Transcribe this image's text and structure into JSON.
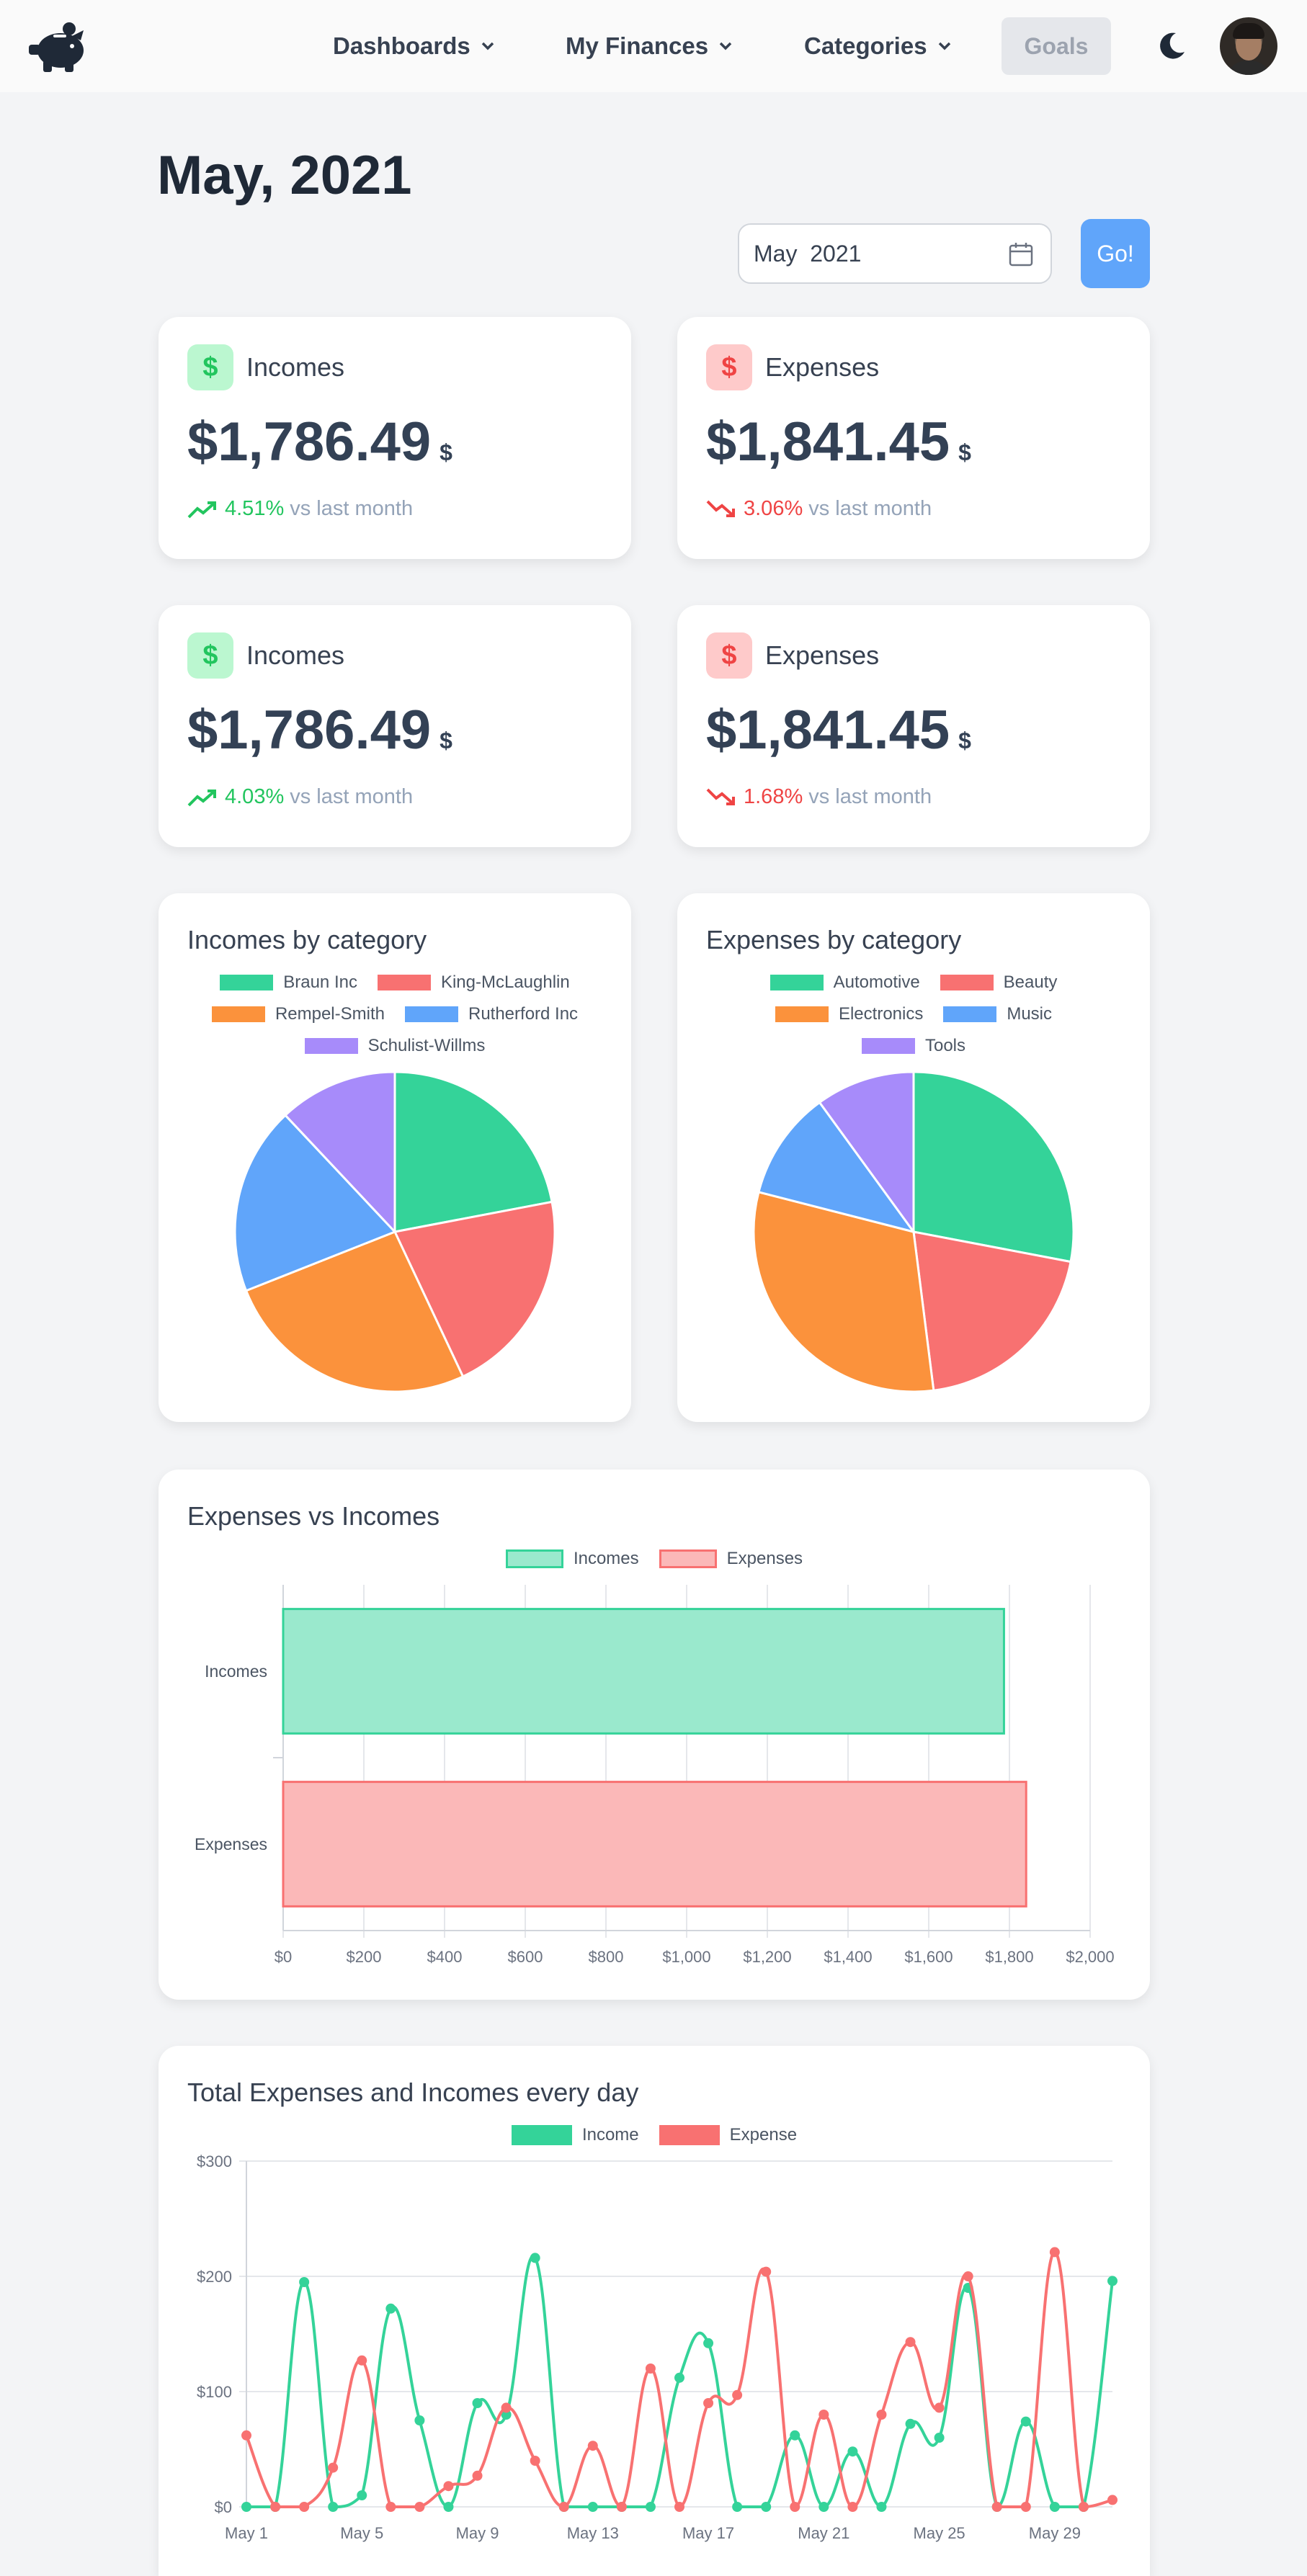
{
  "nav": {
    "items": [
      {
        "label": "Dashboards",
        "left": 462
      },
      {
        "label": "My Finances",
        "left": 785
      },
      {
        "label": "Categories",
        "left": 1116
      }
    ],
    "goals": "Goals"
  },
  "header": {
    "title": "May, 2021",
    "month_value": "May  2021",
    "go_label": "Go!"
  },
  "stats": [
    {
      "label": "Incomes",
      "amount": "$1,786.49",
      "currency": "$",
      "pct": "4.51%",
      "vs": "vs last month",
      "dir": "up"
    },
    {
      "label": "Expenses",
      "amount": "$1,841.45",
      "currency": "$",
      "pct": "3.06%",
      "vs": "vs last month",
      "dir": "down"
    },
    {
      "label": "Incomes",
      "amount": "$1,786.49",
      "currency": "$",
      "pct": "4.03%",
      "vs": "vs last month",
      "dir": "up"
    },
    {
      "label": "Expenses",
      "amount": "$1,841.45",
      "currency": "$",
      "pct": "1.68%",
      "vs": "vs last month",
      "dir": "down"
    }
  ],
  "colors": {
    "green": "#34d399",
    "red": "#f87171",
    "orange": "#fb923c",
    "blue": "#60a5fa",
    "purple": "#a78bfa",
    "accent": "#60a5fa"
  },
  "chart_data": [
    {
      "type": "pie",
      "title": "Incomes by category",
      "labels": [
        "Braun Inc",
        "King-McLaughlin",
        "Rempel-Smith",
        "Rutherford Inc",
        "Schulist-Willms"
      ],
      "values": [
        22,
        21,
        26,
        19,
        12
      ],
      "colors": [
        "#34d399",
        "#f87171",
        "#fb923c",
        "#60a5fa",
        "#a78bfa"
      ],
      "legend": "top"
    },
    {
      "type": "pie",
      "title": "Expenses by category",
      "labels": [
        "Automotive",
        "Beauty",
        "Electronics",
        "Music",
        "Tools"
      ],
      "values": [
        28,
        20,
        31,
        11,
        10
      ],
      "colors": [
        "#34d399",
        "#f87171",
        "#fb923c",
        "#60a5fa",
        "#a78bfa"
      ],
      "legend": "top"
    },
    {
      "type": "bar",
      "orientation": "horizontal",
      "title": "Expenses vs Incomes",
      "categories": [
        "Incomes",
        "Expenses"
      ],
      "series": [
        {
          "name": "Incomes",
          "values": [
            1786.49,
            null
          ]
        },
        {
          "name": "Expenses",
          "values": [
            null,
            1841.45
          ]
        }
      ],
      "xlim": [
        0,
        2000
      ],
      "xticks": [
        "$0",
        "$200",
        "$400",
        "$600",
        "$800",
        "$1,000",
        "$1,200",
        "$1,400",
        "$1,600",
        "$1,800",
        "$2,000"
      ],
      "grid": true,
      "legend": "top"
    },
    {
      "type": "line",
      "title": "Total Expenses and Incomes every day",
      "x": [
        1,
        2,
        3,
        4,
        5,
        6,
        7,
        8,
        9,
        10,
        11,
        12,
        13,
        14,
        15,
        16,
        17,
        18,
        19,
        20,
        21,
        22,
        23,
        24,
        25,
        26,
        27,
        28,
        29,
        30,
        31
      ],
      "xticks": [
        "May 1",
        "May 5",
        "May 9",
        "May 13",
        "May 17",
        "May 21",
        "May 25",
        "May 29"
      ],
      "ylim": [
        0,
        300
      ],
      "yticks": [
        "$0",
        "$100",
        "$200",
        "$300"
      ],
      "series": [
        {
          "name": "Income",
          "color": "#34d399",
          "values": [
            0,
            0,
            195,
            0,
            10,
            172,
            75,
            0,
            90,
            80,
            216,
            0,
            0,
            0,
            0,
            112,
            142,
            0,
            0,
            62,
            0,
            48,
            0,
            72,
            60,
            190,
            0,
            74,
            0,
            0,
            196
          ]
        },
        {
          "name": "Expense",
          "color": "#f87171",
          "values": [
            62,
            0,
            0,
            34,
            127,
            0,
            0,
            18,
            27,
            86,
            40,
            0,
            53,
            0,
            120,
            0,
            90,
            97,
            204,
            0,
            80,
            0,
            80,
            143,
            86,
            200,
            0,
            0,
            221,
            0,
            6
          ]
        }
      ],
      "grid": true,
      "legend": "top"
    }
  ]
}
